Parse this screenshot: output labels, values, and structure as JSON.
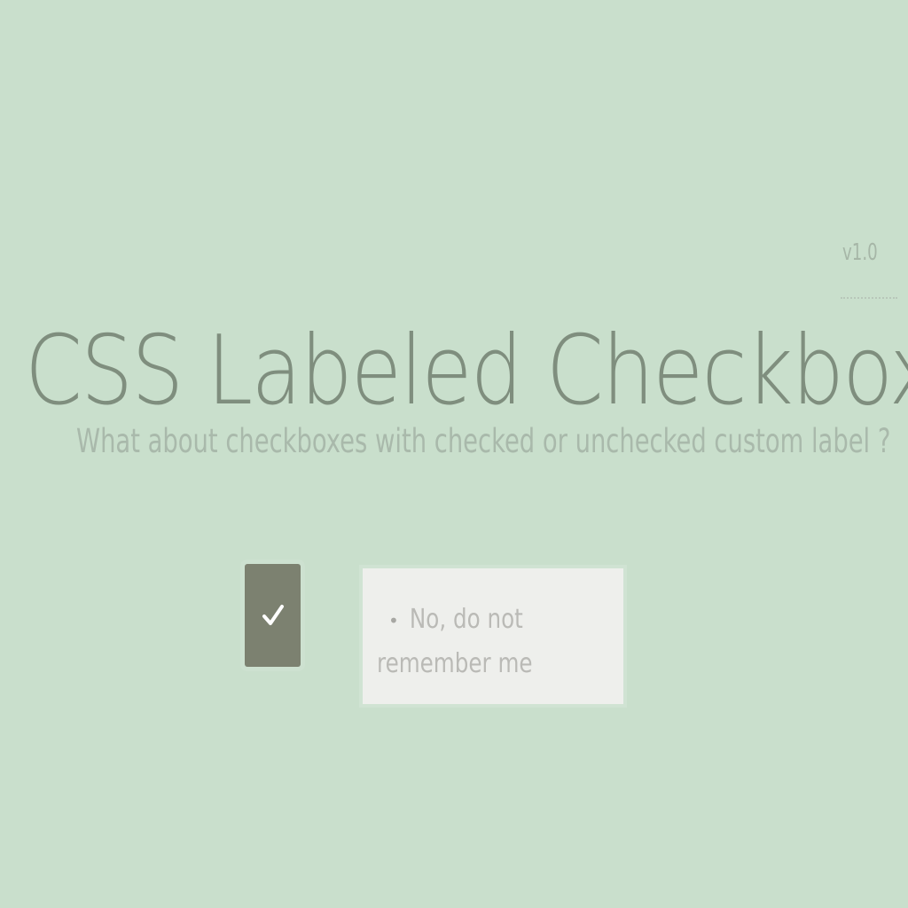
{
  "header": {
    "title": "CSS Labeled Checkbox",
    "version": "v1.0",
    "subtitle": "What about checkboxes with checked or unchecked custom label ?"
  },
  "demo": {
    "checkbox": {
      "checked": true,
      "icon": "check-icon"
    },
    "label": {
      "text": "No, do not remember me",
      "bullet": "•",
      "bullet_icon": "dot-icon"
    }
  },
  "colors": {
    "background": "#c9dfcc",
    "checkbox": "#7c8170",
    "label_card": "#eeefec",
    "title": "#7f8e7e"
  }
}
